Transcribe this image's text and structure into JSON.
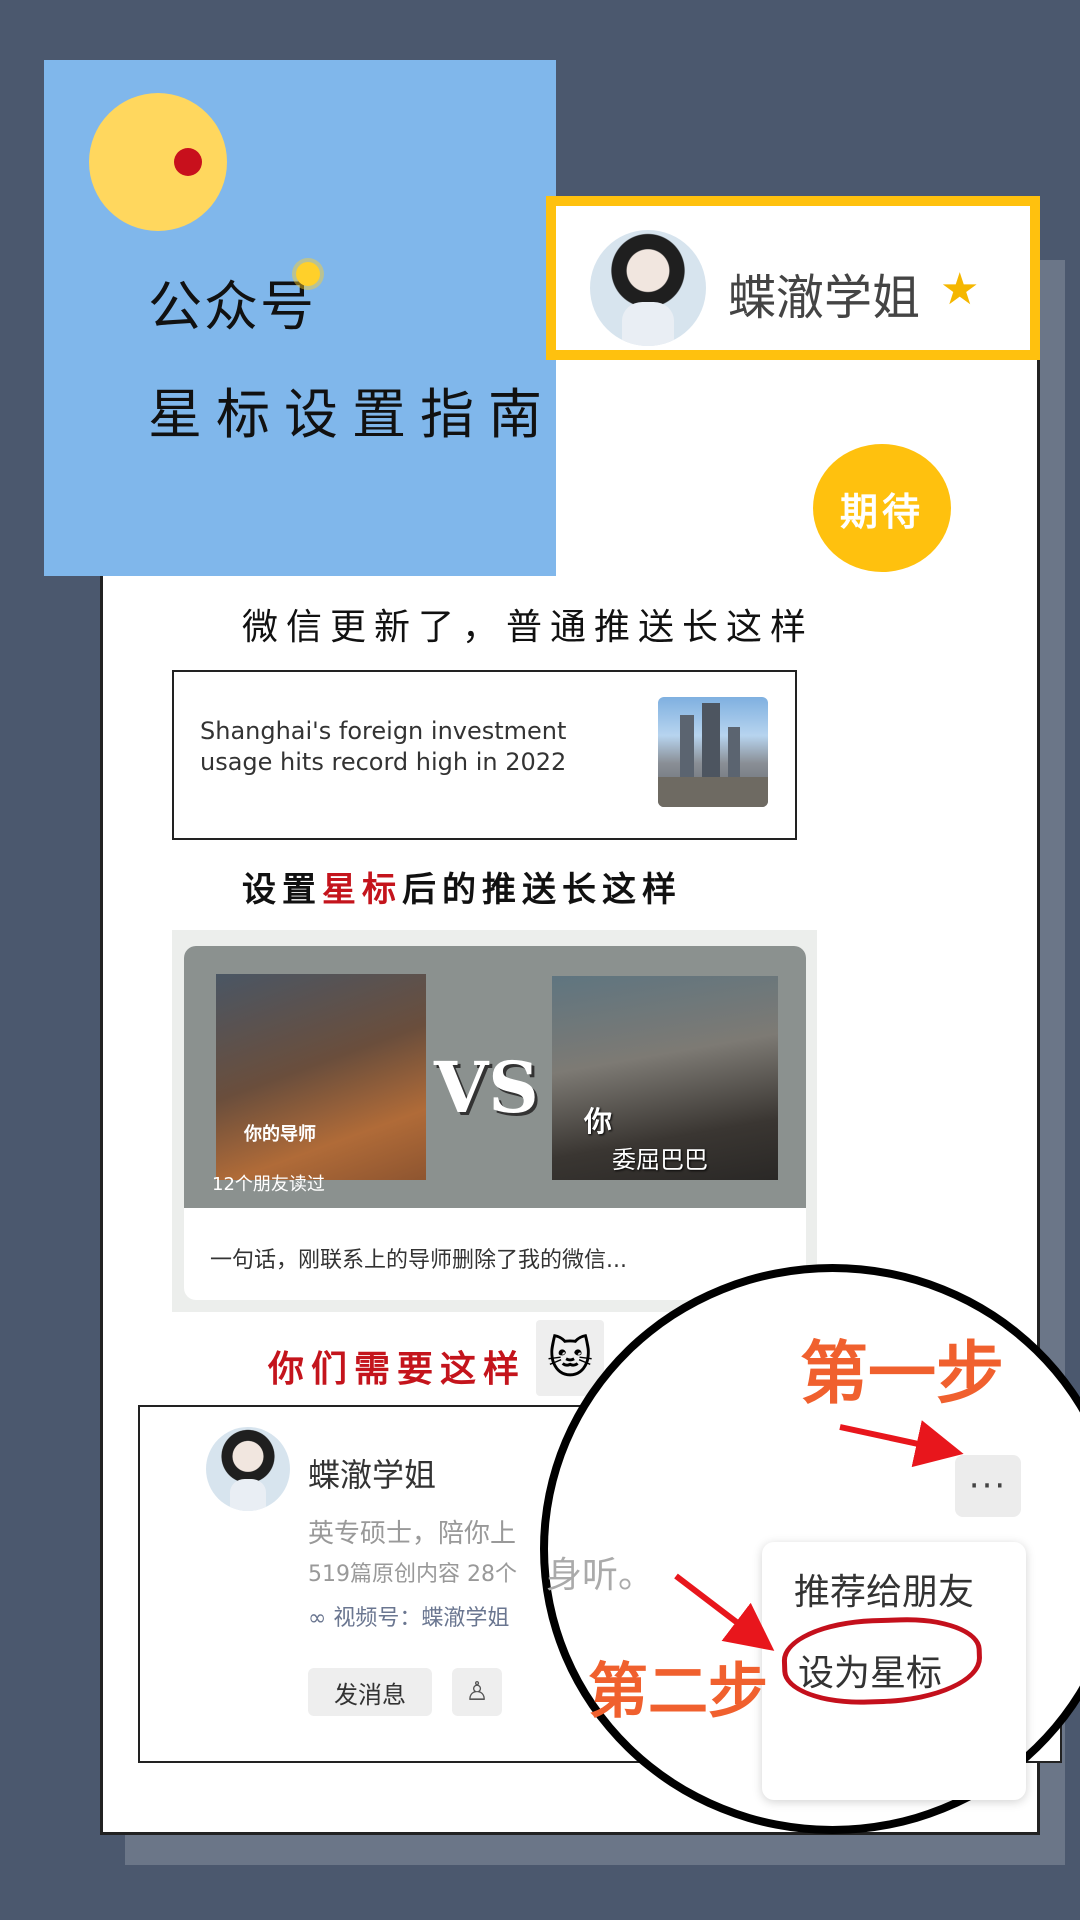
{
  "header": {
    "title_line1": "公众号",
    "title_line2": "星标设置指南"
  },
  "profile": {
    "name": "蝶澈学姐",
    "star_glyph": "★"
  },
  "expect_badge": "期待",
  "section_normal": {
    "heading": "微信更新了，普通推送长这样",
    "article_title": "Shanghai's foreign investment usage hits record high in 2022"
  },
  "section_starred": {
    "heading_pre": "设置",
    "heading_red": "星标",
    "heading_post": "后的推送长这样",
    "vs_text": "VS",
    "left_caption": "你的导师",
    "right_caption_top": "你",
    "right_caption_bottom": "委屈巴巴",
    "friends_read": "12个朋友读过",
    "article_desc": "一句话，刚联系上的导师删除了我的微信..."
  },
  "section_need": {
    "heading": "你们需要这样",
    "emoji": "🐱"
  },
  "account_page": {
    "name": "蝶澈学姐",
    "bio": "英专硕士，陪你上",
    "stats": "519篇原创内容  28个",
    "bio_tail": "身听。",
    "video_channel": "视频号：蝶澈学姐",
    "send_message": "发消息",
    "user_icon": "user-icon"
  },
  "magnifier": {
    "step1": "第一步",
    "step2": "第二步",
    "more_glyph": "···",
    "menu_recommend": "推荐给朋友",
    "menu_set_star": "设为星标"
  },
  "colors": {
    "background": "#4b586e",
    "panel_blue": "#80b7eb",
    "accent_yellow": "#ffc10e",
    "accent_red": "#c4141c",
    "step_orange": "#f0602e"
  }
}
